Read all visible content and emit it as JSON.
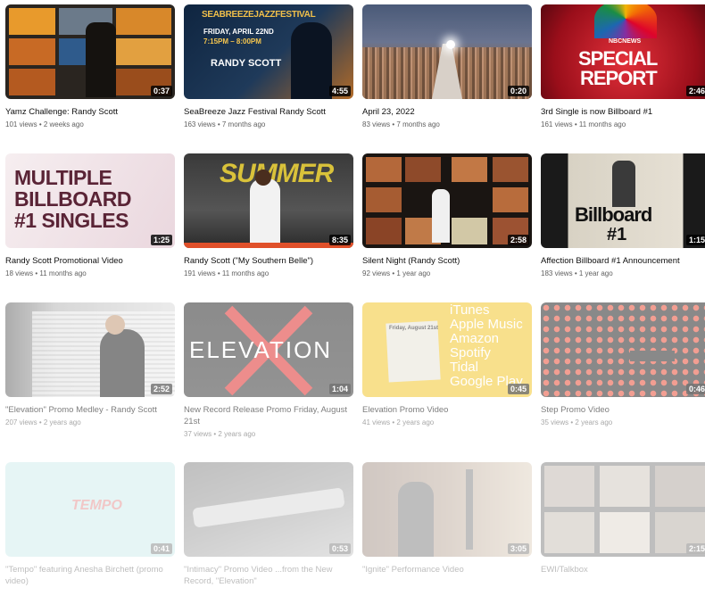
{
  "videos": [
    {
      "title": "Yamz Challenge: Randy Scott",
      "views": "101 views",
      "age": "2 weeks ago",
      "duration": "0:37"
    },
    {
      "title": "SeaBreeze Jazz Festival Randy Scott",
      "views": "163 views",
      "age": "7 months ago",
      "duration": "4:55",
      "overlay": {
        "fest": "SEABREEZEJAZZFESTIVAL",
        "date": "FRIDAY, APRIL 22ND",
        "time": "7:15PM – 8:00PM",
        "artist": "RANDY SCOTT"
      }
    },
    {
      "title": "April 23, 2022",
      "views": "83 views",
      "age": "7 months ago",
      "duration": "0:20"
    },
    {
      "title": "3rd Single is now Billboard #1",
      "views": "161 views",
      "age": "11 months ago",
      "duration": "2:46",
      "overlay": {
        "brand": "NBCNEWS",
        "line1": "SPECIAL",
        "line2": "REPORT"
      }
    },
    {
      "title": "Randy Scott Promotional Video",
      "views": "18 views",
      "age": "11 months ago",
      "duration": "1:25",
      "overlay": {
        "line1": "MULTIPLE",
        "line2": "BILLBOARD",
        "line3": "#1 SINGLES"
      }
    },
    {
      "title": "Randy Scott (\"My Southern Belle\")",
      "views": "191 views",
      "age": "11 months ago",
      "duration": "8:35",
      "overlay": {
        "word": "SUMMER"
      }
    },
    {
      "title": "Silent Night (Randy Scott)",
      "views": "92 views",
      "age": "1 year ago",
      "duration": "2:58"
    },
    {
      "title": "Affection Billboard #1 Announcement",
      "views": "183 views",
      "age": "1 year ago",
      "duration": "1:15",
      "overlay": {
        "word": "Billboard",
        "num": "#1"
      }
    },
    {
      "title": "\"Elevation\" Promo Medley - Randy Scott",
      "views": "207 views",
      "age": "2 years ago",
      "duration": "2:52"
    },
    {
      "title": "New Record Release Promo Friday, August 21st",
      "views": "37 views",
      "age": "2 years ago",
      "duration": "1:04",
      "overlay": {
        "word": "ELEVATION"
      }
    },
    {
      "title": "Elevation Promo Video",
      "views": "41 views",
      "age": "2 years ago",
      "duration": "0:45",
      "overlay": {
        "l1": "iTunes",
        "l2": "Apple Music",
        "l3": "Amazon",
        "l4": "Spotify",
        "l5": "Tidal",
        "l6": "Google Play",
        "card": "Friday, August 21st"
      }
    },
    {
      "title": "Step Promo Video",
      "views": "35 views",
      "age": "2 years ago",
      "duration": "0:46"
    },
    {
      "title": "\"Tempo\" featuring Anesha Birchett (promo video)",
      "views": "",
      "age": "",
      "duration": "0:41",
      "overlay": {
        "word": "TEMPO"
      }
    },
    {
      "title": "\"Intimacy\" Promo Video ...from the New Record, \"Elevation\"",
      "views": "",
      "age": "",
      "duration": "0:53"
    },
    {
      "title": "\"Ignite\" Performance Video",
      "views": "",
      "age": "",
      "duration": "3:05"
    },
    {
      "title": "EWI/Talkbox",
      "views": "",
      "age": "",
      "duration": "2:15"
    }
  ],
  "separator": "•"
}
